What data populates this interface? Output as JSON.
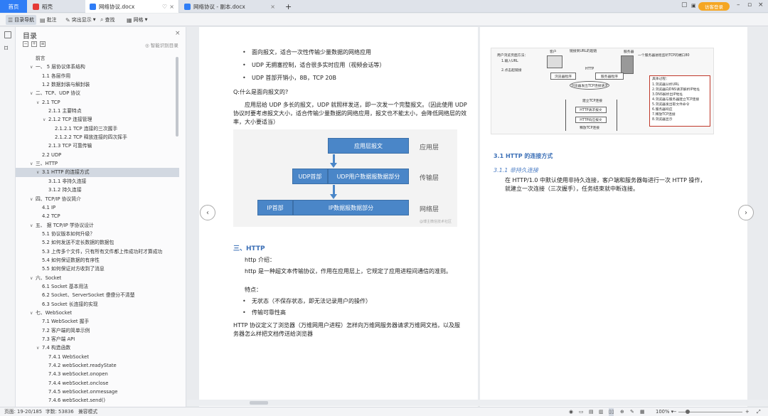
{
  "tabs": [
    {
      "label": "首页"
    },
    {
      "label": "稻壳"
    },
    {
      "label": "网络协议.docx"
    },
    {
      "label": "网络协议 - 副本.docx"
    }
  ],
  "titlebar": {
    "login_label": "访客登录"
  },
  "toolbar": {
    "items": [
      "目录导航",
      "批注",
      "突出显示",
      "查找",
      "网格"
    ]
  },
  "toc": {
    "title": "目录",
    "smart_label": "智能识别目录",
    "items": [
      {
        "label": "前言",
        "level": 0,
        "arrow": ""
      },
      {
        "label": "一、 5 层协议体系结构",
        "level": 0,
        "arrow": "v"
      },
      {
        "label": "1.1 各层作用",
        "level": 1,
        "arrow": ""
      },
      {
        "label": "1.2 数据封装与解封装",
        "level": 1,
        "arrow": ""
      },
      {
        "label": "二、TCP、UDP 协议",
        "level": 0,
        "arrow": "v"
      },
      {
        "label": "2.1 TCP",
        "level": 1,
        "arrow": "v"
      },
      {
        "label": "2.1.1 主要特点",
        "level": 2,
        "arrow": ""
      },
      {
        "label": "2.1.2 TCP 连接管理",
        "level": 2,
        "arrow": "v"
      },
      {
        "label": "2.1.2.1 TCP 连接的三次握手",
        "level": 3,
        "arrow": ""
      },
      {
        "label": "2.1.2.2 TCP 释放连接的四次挥手",
        "level": 3,
        "arrow": ""
      },
      {
        "label": "2.1.3 TCP 可靠传输",
        "level": 2,
        "arrow": ""
      },
      {
        "label": "2.2 UDP",
        "level": 1,
        "arrow": ""
      },
      {
        "label": "三、HTTP",
        "level": 0,
        "arrow": "v"
      },
      {
        "label": "3.1 HTTP 的连接方式",
        "level": 1,
        "arrow": "v",
        "selected": true
      },
      {
        "label": "3.1.1 非持久连接",
        "level": 2,
        "arrow": ""
      },
      {
        "label": "3.1.2 持久连接",
        "level": 2,
        "arrow": ""
      },
      {
        "label": "四、TCP/IP 协议简介",
        "level": 0,
        "arrow": "v"
      },
      {
        "label": "4.1 IP",
        "level": 1,
        "arrow": ""
      },
      {
        "label": "4.2 TCP",
        "level": 1,
        "arrow": ""
      },
      {
        "label": "五、 据 TCP/IP 学协议设计",
        "level": 0,
        "arrow": "v"
      },
      {
        "label": "5.1 协议版本如何升级？",
        "level": 1,
        "arrow": ""
      },
      {
        "label": "5.2 如何发送不定长数据的数据包",
        "level": 1,
        "arrow": ""
      },
      {
        "label": "5.3 上传多个文件，只有所有文件都上传成功时才算成功",
        "level": 1,
        "arrow": ""
      },
      {
        "label": "5.4 如何保证数据的有序性",
        "level": 1,
        "arrow": ""
      },
      {
        "label": "5.5 如何保证对方收到了消息",
        "level": 1,
        "arrow": ""
      },
      {
        "label": "六、Socket",
        "level": 0,
        "arrow": "v"
      },
      {
        "label": "6.1 Socket 基本用法",
        "level": 1,
        "arrow": ""
      },
      {
        "label": "6.2 Socket、ServerSocket 傻傻分不清楚",
        "level": 1,
        "arrow": ""
      },
      {
        "label": "6.3 Socket 长连接的实现",
        "level": 1,
        "arrow": ""
      },
      {
        "label": "七、WebSocket",
        "level": 0,
        "arrow": "v"
      },
      {
        "label": "7.1 WebSocket 握手",
        "level": 1,
        "arrow": ""
      },
      {
        "label": "7.2 客户端的简单示例",
        "level": 1,
        "arrow": ""
      },
      {
        "label": "7.3 客户端 API",
        "level": 1,
        "arrow": ""
      },
      {
        "label": "7.4 构造函数",
        "level": 1,
        "arrow": "v"
      },
      {
        "label": "7.4.1 WebSocket",
        "level": 2,
        "arrow": ""
      },
      {
        "label": "7.4.2 webSocket.readyState",
        "level": 2,
        "arrow": ""
      },
      {
        "label": "7.4.3 webSocket.onopen",
        "level": 2,
        "arrow": ""
      },
      {
        "label": "7.4.4 webSocket.onclose",
        "level": 2,
        "arrow": ""
      },
      {
        "label": "7.4.5 webSocket.onmessage",
        "level": 2,
        "arrow": ""
      },
      {
        "label": "7.4.6 webSocket.send()",
        "level": 2,
        "arrow": ""
      }
    ]
  },
  "doc_left": {
    "b1": "面向报文，适合一次性传输少量数据的网络应用",
    "b2": "UDP 无拥塞控制，适合很多实时应用（视频会话等）",
    "b3": "UDP 首部开销小，8B，TCP 20B",
    "q": "Q:什么是面向报文的?",
    "p1": "应用层给 UDP 多长的报文，UDP 就照样发送，即一次发一个完整报文。（因此使用 UDP 协议时要考虑报文大小，适合传输少量数据的网络应用，报文也不能太小，会降低网络层的效率，大小要适当）",
    "diagram": {
      "app_box": "应用层报文",
      "app_layer": "应用层",
      "udp_head": "UDP首部",
      "udp_data": "UDP用户数据报数据部分",
      "transport_layer": "传输层",
      "ip_head": "IP首部",
      "ip_data": "IP数据报数据部分",
      "network_layer": "网络层",
      "watermark": "@博主微信技术社区"
    },
    "h3": "三、HTTP",
    "intro": "http 介绍：",
    "p2": "http 是一种超文本传输协议，作用在应用层上，它规定了应用进程间通信的准则。",
    "feat": "特点：",
    "b4": "无状态（不保存状态，即无法记录用户的操作）",
    "b5": "传输可靠性高",
    "p3": "HTTP 协议定义了浏览器（万维网用户进程）怎样向万维网服务器请求万维网文档，以及服务器怎么样把文档传送给浏览器"
  },
  "doc_right": {
    "fig": {
      "l1": "用户浏览页面方法：",
      "l2": "1.输入URL",
      "l3": "2.点击超链接",
      "client": "客户",
      "server": "服务器",
      "link": "链接到URL的超链",
      "server_note": "一个服务器进程监听TCP的端口80",
      "browser": "浏览器程序",
      "server_prog": "服务器程序",
      "http": "HTTP",
      "tcp_conn": "浏览器发出TCP连接请求",
      "tcp_est": "建立TCP连接",
      "req": "HTTP请求报文",
      "resp": "HTTP响应报文",
      "release": "释放TCP连接",
      "s1": "具体过程：",
      "s2": "1.浏览器分析URL",
      "s3": "2.浏览器向DNS请求解析IP地址",
      "s4": "3.DNS解析出IP地址",
      "s5": "4.浏览器与服务器建立TCP连接",
      "s6": "5.浏览器发出取文件命令",
      "s7": "6.服务器响应",
      "s8": "7.释放TCP连接",
      "s9": "8.浏览器显示"
    },
    "h31": "3.1 HTTP 的连接方式",
    "h311": "3.1.1 非持久连接",
    "p1": "在 HTTP/1.0 中默认使用非持久连接，客户端和服务器每进行一次 HTTP 操作，就建立一次连接（三次握手），任务结束就中断连接。"
  },
  "status": {
    "pages": "页面: 19-20/185",
    "words": "字数: 53836",
    "mode": "兼容模式",
    "zoom": "100%"
  }
}
